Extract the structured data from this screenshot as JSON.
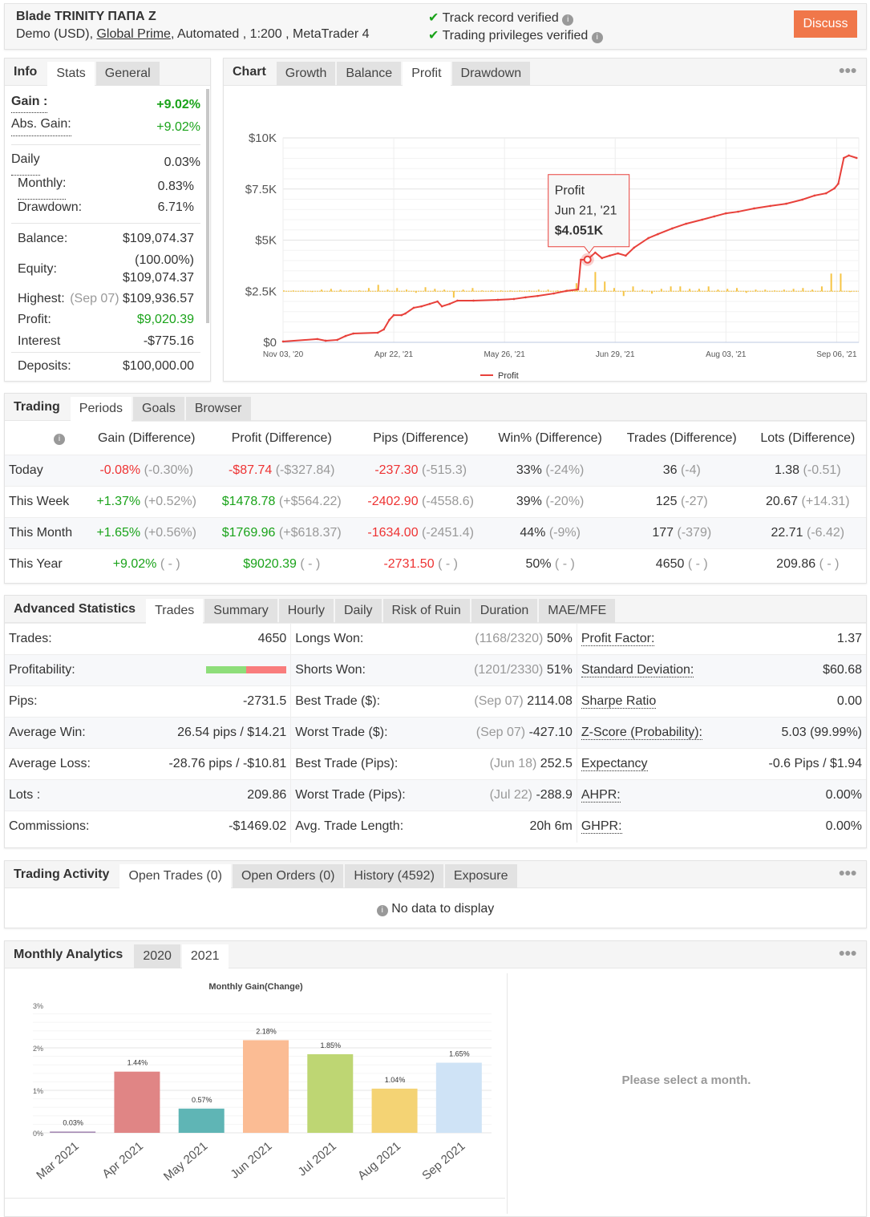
{
  "header": {
    "title": "Blade TRINITY ΠΑΠΑ Z",
    "sub_prefix": "Demo (USD), ",
    "broker": "Global Prime",
    "sub_suffix": ", Automated , 1:200 , MetaTrader 4",
    "verify1": "Track record verified",
    "verify2": "Trading privileges verified",
    "discuss": "Discuss",
    "accent": "#f0774a"
  },
  "info": {
    "tabs": [
      "Info",
      "Stats",
      "General"
    ],
    "gain_label": "Gain :",
    "gain": "+9.02%",
    "abs_label": "Abs. Gain:",
    "abs": "+9.02%",
    "daily_label": "Daily",
    "daily": "0.03%",
    "monthly_label": "Monthly:",
    "monthly": "0.83%",
    "dd_label": "Drawdown:",
    "dd": "6.71%",
    "balance_label": "Balance:",
    "balance": "$109,074.37",
    "equity_label": "Equity:",
    "equity_pct": "(100.00%)",
    "equity": "$109,074.37",
    "highest_label": "Highest:",
    "highest_date": "(Sep 07)",
    "highest": "$109,936.57",
    "profit_label": "Profit:",
    "profit": "$9,020.39",
    "interest_label": "Interest",
    "interest": "-$775.16",
    "deposits_label": "Deposits:",
    "deposits": "$100,000.00"
  },
  "chart_tabs": [
    "Chart",
    "Growth",
    "Balance",
    "Profit",
    "Drawdown"
  ],
  "chart_data": [
    {
      "type": "line",
      "title": "Profit",
      "ylim": [
        0,
        10000
      ],
      "yticks": [
        "$0",
        "$2.5K",
        "$5K",
        "$7.5K",
        "$10K"
      ],
      "ytick_values": [
        0,
        2500,
        5000,
        7500,
        10000
      ],
      "xticks": [
        "Nov 03, '20",
        "Apr 22, '21",
        "May 26, '21",
        "Jun 29, '21",
        "Aug 03, '21",
        "Sep 06, '21"
      ],
      "xtick_index": [
        0,
        20,
        40,
        60,
        80,
        100
      ],
      "xlim": [
        0,
        104
      ],
      "legend": "Profit",
      "legend_position": "bottom",
      "line_color": "#e8413b",
      "bar_color": "#f6c445",
      "series": [
        {
          "name": "Profit",
          "points": [
            [
              0,
              40
            ],
            [
              6.2,
              160
            ],
            [
              7.7,
              80
            ],
            [
              9.8,
              120
            ],
            [
              11.3,
              310
            ],
            [
              12.7,
              430
            ],
            [
              17.1,
              470
            ],
            [
              18.2,
              630
            ],
            [
              19.2,
              1100
            ],
            [
              20,
              1330
            ],
            [
              21.4,
              1330
            ],
            [
              22.1,
              1410
            ],
            [
              23.6,
              1690
            ],
            [
              25,
              1760
            ],
            [
              26.5,
              1880
            ],
            [
              27.9,
              2000
            ],
            [
              28.7,
              1760
            ],
            [
              30.1,
              1880
            ],
            [
              31.5,
              2040
            ],
            [
              34.4,
              2040
            ],
            [
              38.8,
              2080
            ],
            [
              41.7,
              2120
            ],
            [
              43.8,
              2200
            ],
            [
              46,
              2270
            ],
            [
              48.9,
              2390
            ],
            [
              51.1,
              2510
            ],
            [
              53.3,
              2590
            ],
            [
              53.8,
              4040
            ],
            [
              55,
              4051
            ],
            [
              56.4,
              4390
            ],
            [
              57.6,
              4120
            ],
            [
              59,
              4240
            ],
            [
              60.5,
              4350
            ],
            [
              61.9,
              4240
            ],
            [
              63.4,
              4630
            ],
            [
              66,
              5100
            ],
            [
              67.7,
              5290
            ],
            [
              70.3,
              5570
            ],
            [
              72.8,
              5800
            ],
            [
              75.7,
              6000
            ],
            [
              77.9,
              6160
            ],
            [
              80,
              6310
            ],
            [
              82.2,
              6390
            ],
            [
              85.1,
              6550
            ],
            [
              88,
              6670
            ],
            [
              90.9,
              6780
            ],
            [
              93.8,
              6980
            ],
            [
              96,
              7180
            ],
            [
              98.1,
              7290
            ],
            [
              99.6,
              7530
            ],
            [
              100.3,
              7760
            ],
            [
              101.3,
              9020
            ],
            [
              102.2,
              9140
            ],
            [
              103.6,
              9020
            ]
          ]
        },
        {
          "name": "Daily",
          "baseline": 2500,
          "values": [
            10,
            10,
            10,
            -10,
            20,
            30,
            20,
            10,
            10,
            40,
            80,
            20,
            40,
            20,
            -20,
            50,
            30,
            20,
            -80,
            20,
            40,
            10,
            10,
            10,
            10,
            10,
            10,
            20,
            20,
            10,
            20,
            100,
            40,
            240,
            120,
            40,
            -60,
            60,
            20,
            -30,
            30,
            60,
            60,
            30,
            30,
            60,
            20,
            30,
            40,
            -20,
            20,
            20,
            10,
            20,
            30,
            40,
            20,
            60,
            220,
            220,
            -10
          ]
        }
      ],
      "tooltip": {
        "label": "Profit",
        "date": "Jun 21, '21",
        "value": "$4.051K",
        "index": 55,
        "y": 4051
      }
    },
    {
      "type": "bar",
      "title": "Monthly Gain(Change)",
      "categories": [
        "Mar 2021",
        "Apr 2021",
        "May 2021",
        "Jun 2021",
        "Jul 2021",
        "Aug 2021",
        "Sep 2021"
      ],
      "values": [
        0.03,
        1.44,
        0.57,
        2.18,
        1.85,
        1.04,
        1.65
      ],
      "labels": [
        "0.03%",
        "1.44%",
        "0.57%",
        "2.18%",
        "1.85%",
        "1.04%",
        "1.65%"
      ],
      "colors": [
        "#a58ab3",
        "#e08585",
        "#5fb5b5",
        "#fbbc94",
        "#bed673",
        "#f4d374",
        "#cfe3f6"
      ],
      "ylim": [
        0,
        3
      ],
      "yticks": [
        "0%",
        "1%",
        "2%",
        "3%"
      ]
    }
  ],
  "trading": {
    "tabs": [
      "Trading",
      "Periods",
      "Goals",
      "Browser"
    ],
    "headers": [
      "Gain (Difference)",
      "Profit (Difference)",
      "Pips (Difference)",
      "Win% (Difference)",
      "Trades (Difference)",
      "Lots (Difference)"
    ],
    "rows": [
      {
        "label": "Today",
        "cells": [
          [
            "-0.08%",
            "(-0.30%)",
            "red"
          ],
          [
            "-$87.74",
            "(-$327.84)",
            "red"
          ],
          [
            "-237.30",
            "(-515.3)",
            "red"
          ],
          [
            "33%",
            "(-24%)",
            ""
          ],
          [
            "36",
            "(-4)",
            ""
          ],
          [
            "1.38",
            "(-0.51)",
            ""
          ]
        ]
      },
      {
        "label": "This Week",
        "cells": [
          [
            "+1.37%",
            "(+0.52%)",
            "green"
          ],
          [
            "$1478.78",
            "(+$564.22)",
            "green"
          ],
          [
            "-2402.90",
            "(-4558.6)",
            "red"
          ],
          [
            "39%",
            "(-20%)",
            ""
          ],
          [
            "125",
            "(-27)",
            ""
          ],
          [
            "20.67",
            "(+14.31)",
            ""
          ]
        ]
      },
      {
        "label": "This Month",
        "cells": [
          [
            "+1.65%",
            "(+0.56%)",
            "green"
          ],
          [
            "$1769.96",
            "(+$618.37)",
            "green"
          ],
          [
            "-1634.00",
            "(-2451.4)",
            "red"
          ],
          [
            "44%",
            "(-9%)",
            ""
          ],
          [
            "177",
            "(-379)",
            ""
          ],
          [
            "22.71",
            "(-6.42)",
            ""
          ]
        ]
      },
      {
        "label": "This Year",
        "cells": [
          [
            "+9.02%",
            "( - )",
            "green"
          ],
          [
            "$9020.39",
            "( - )",
            "green"
          ],
          [
            "-2731.50",
            "( - )",
            "red"
          ],
          [
            "50%",
            "( - )",
            ""
          ],
          [
            "4650",
            "( - )",
            ""
          ],
          [
            "209.86",
            "( - )",
            ""
          ]
        ]
      }
    ]
  },
  "advanced": {
    "tabs": [
      "Advanced Statistics",
      "Trades",
      "Summary",
      "Hourly",
      "Daily",
      "Risk of Ruin",
      "Duration",
      "MAE/MFE"
    ],
    "rows": [
      [
        [
          "Trades:",
          "",
          "4650"
        ],
        [
          "Longs Won:",
          "(1168/2320)",
          "50%"
        ],
        [
          "Profit Factor:",
          "",
          "1.37"
        ]
      ],
      [
        [
          "Profitability:",
          "",
          "BAR"
        ],
        [
          "Shorts Won:",
          "(1201/2330)",
          "51%"
        ],
        [
          "Standard Deviation:",
          "",
          "$60.68"
        ]
      ],
      [
        [
          "Pips:",
          "",
          "-2731.5"
        ],
        [
          "Best Trade ($):",
          "(Sep 07)",
          "2114.08"
        ],
        [
          "Sharpe Ratio",
          "",
          "0.00"
        ]
      ],
      [
        [
          "Average Win:",
          "",
          "26.54 pips / $14.21"
        ],
        [
          "Worst Trade ($):",
          "(Sep 07)",
          "-427.10"
        ],
        [
          "Z-Score (Probability):",
          "",
          "5.03 (99.99%)"
        ]
      ],
      [
        [
          "Average Loss:",
          "",
          "-28.76 pips / -$10.81"
        ],
        [
          "Best Trade (Pips):",
          "(Jun 18)",
          "252.5"
        ],
        [
          "Expectancy",
          "",
          "-0.6 Pips / $1.94"
        ]
      ],
      [
        [
          "Lots :",
          "",
          "209.86"
        ],
        [
          "Worst Trade (Pips):",
          "(Jul 22)",
          "-288.9"
        ],
        [
          "AHPR:",
          "",
          "0.00%"
        ]
      ],
      [
        [
          "Commissions:",
          "",
          "-$1469.02"
        ],
        [
          "Avg. Trade Length:",
          "",
          "20h 6m"
        ],
        [
          "GHPR:",
          "",
          "0.00%"
        ]
      ]
    ],
    "profitability_win_fraction": 0.5
  },
  "activity": {
    "tabs": [
      "Trading Activity",
      "Open Trades (0)",
      "Open Orders (0)",
      "History (4592)",
      "Exposure"
    ],
    "empty": "No data to display"
  },
  "monthly": {
    "tabs": [
      "Monthly Analytics",
      "2020",
      "2021"
    ],
    "select_msg": "Please select a month."
  }
}
